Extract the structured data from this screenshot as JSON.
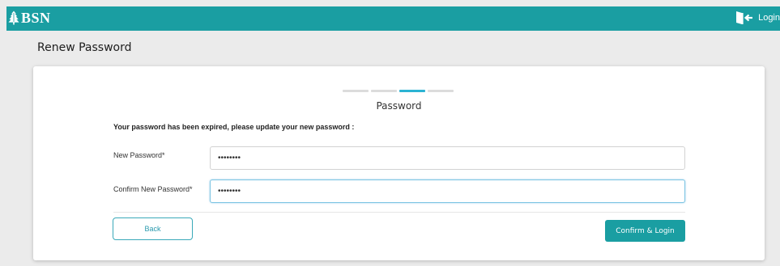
{
  "header": {
    "brand": "BSN",
    "login_label": "Login"
  },
  "page": {
    "title": "Renew Password"
  },
  "form": {
    "stepper": {
      "total": 4,
      "active_step": 3
    },
    "section_title": "Password",
    "notice": "Your password has been expired, please update your new password :",
    "new_password": {
      "label": "New Password*",
      "value": "••••••••"
    },
    "confirm_password": {
      "label": "Confirm New Password*",
      "value": "••••••••"
    },
    "back_label": "Back",
    "confirm_label": "Confirm & Login"
  },
  "colors": {
    "brand": "#1a9ea2",
    "step_active": "#2bb3d3",
    "step_inactive": "#dcdcdc"
  },
  "icons": {
    "brand": "bsn-tree-logo-icon",
    "login": "login-door-icon"
  }
}
